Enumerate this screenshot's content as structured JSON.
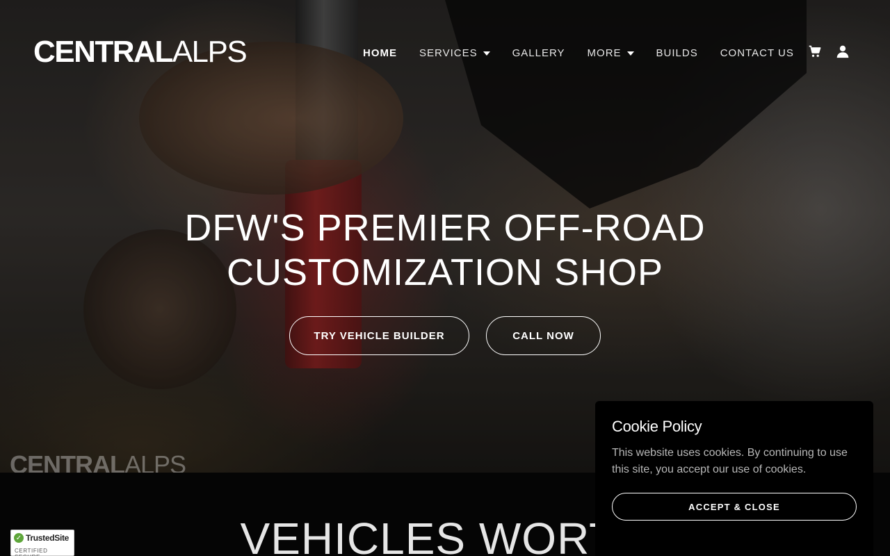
{
  "brand": {
    "logo_bold": "CENTRAL",
    "logo_light": "ALPS"
  },
  "nav": {
    "items": [
      {
        "label": "HOME",
        "active": true,
        "dropdown": false
      },
      {
        "label": "SERVICES",
        "active": false,
        "dropdown": true
      },
      {
        "label": "GALLERY",
        "active": false,
        "dropdown": false
      },
      {
        "label": "MORE",
        "active": false,
        "dropdown": true
      },
      {
        "label": "BUILDS",
        "active": false,
        "dropdown": false
      },
      {
        "label": "CONTACT US",
        "active": false,
        "dropdown": false
      }
    ],
    "icons": [
      "cart-icon",
      "user-icon"
    ]
  },
  "hero": {
    "headline_line1": "DFW'S PREMIER OFF-ROAD",
    "headline_line2": "CUSTOMIZATION SHOP",
    "primary_button": "TRY VEHICLE BUILDER",
    "secondary_button": "CALL NOW",
    "watermark_bold": "CENTRAL",
    "watermark_light": "ALPS"
  },
  "section": {
    "title": "VEHICLES WORTH"
  },
  "badge": {
    "name": "TrustedSite",
    "subtitle": "CERTIFIED SECURE"
  },
  "cookie": {
    "title": "Cookie Policy",
    "text": "This website uses cookies. By continuing to use this site, you accept our use of cookies.",
    "button": "ACCEPT & CLOSE"
  },
  "colors": {
    "background": "#050505",
    "text": "#ffffff",
    "cookie_bg": "#000000",
    "badge_check": "#5ea63a"
  }
}
